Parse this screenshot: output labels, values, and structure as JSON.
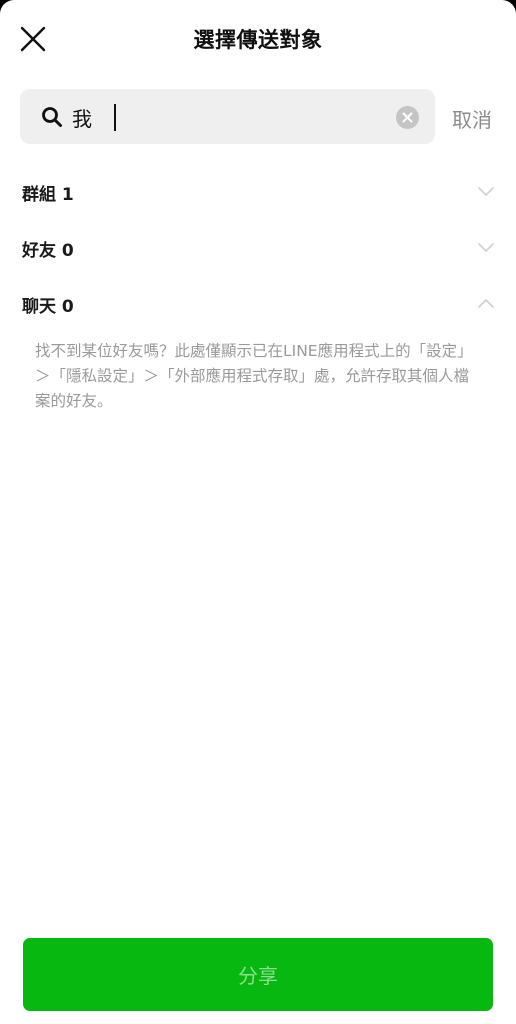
{
  "header": {
    "title": "選擇傳送對象",
    "close_icon": "close-icon"
  },
  "search": {
    "value": "我",
    "search_icon": "search-icon",
    "clear_icon": "clear-icon",
    "cancel_label": "取消"
  },
  "sections": [
    {
      "label": "群組 1",
      "chevron": "chevron-down-icon"
    },
    {
      "label": "好友 0",
      "chevron": "chevron-down-icon"
    },
    {
      "label": "聊天 0",
      "chevron": "chevron-up-icon"
    }
  ],
  "info": {
    "text": "找不到某位好友嗎？此處僅顯示已在LINE應用程式上的「設定」＞「隱私設定」＞「外部應用程式存取」處，允許存取其個人檔案的好友。"
  },
  "footer": {
    "share_label": "分享"
  },
  "colors": {
    "accent": "#06b80f",
    "share_text": "#8fdc92",
    "search_bg": "#efefef",
    "muted_text": "#9a9a9a"
  }
}
